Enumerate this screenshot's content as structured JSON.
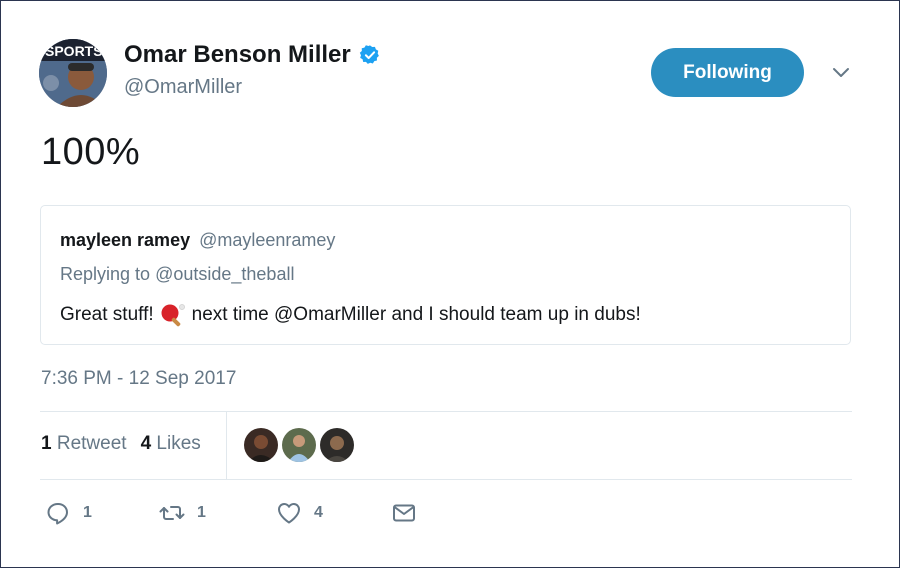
{
  "author": {
    "display_name": "Omar Benson Miller",
    "handle": "@OmarMiller",
    "avatar_icon": "user-avatar",
    "avatar_caption": "SPORTS",
    "verified_icon": "verified-badge-icon"
  },
  "follow_button": {
    "label": "Following",
    "color": "#2b8ec0"
  },
  "tweet": {
    "text": "100%"
  },
  "quoted_tweet": {
    "author_name": "mayleen ramey",
    "author_handle": "@mayleenramey",
    "replying_prefix": "Replying to",
    "replying_to": "@outside_theball",
    "body_before_emoji": "Great stuff!",
    "emoji_icon": "ping-pong-paddle-icon",
    "body_after_emoji": "next time @OmarMiller and I should team up in dubs!"
  },
  "timestamp": "7:36 PM - 12 Sep 2017",
  "stats": {
    "retweet_count": "1",
    "retweet_label": "Retweet",
    "like_count": "4",
    "like_label": "Likes"
  },
  "actions": {
    "reply_count": "1",
    "retweet_count": "1",
    "like_count": "4"
  },
  "colors": {
    "accent": "#2b8ec0",
    "verified": "#1da1f2",
    "muted": "#657786",
    "border": "#e1e8ed"
  }
}
